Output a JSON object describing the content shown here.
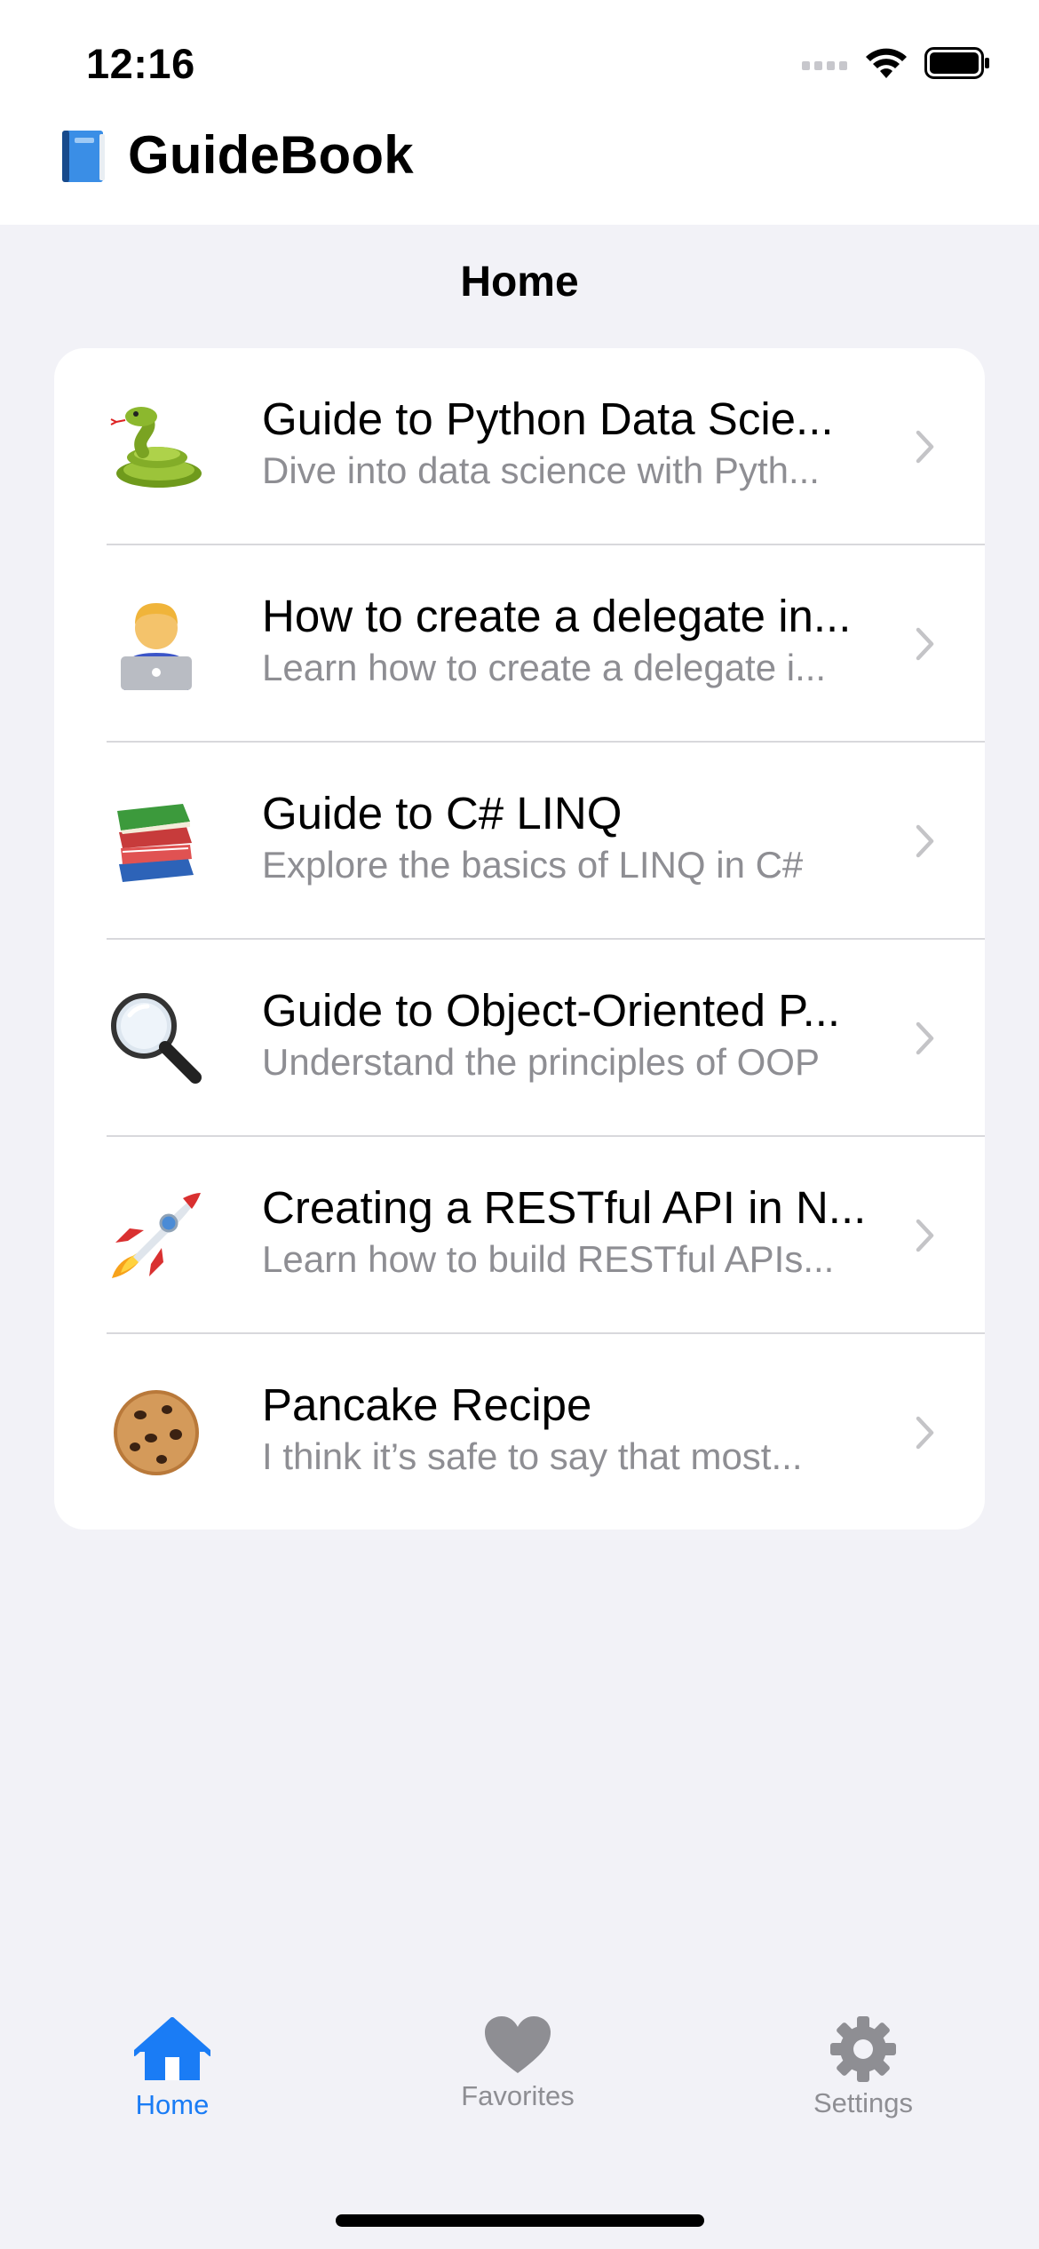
{
  "status_bar": {
    "time": "12:16"
  },
  "header": {
    "app_icon": "blue-book-icon",
    "app_name": "GuideBook"
  },
  "page": {
    "title": "Home"
  },
  "guides": [
    {
      "icon": "snake-emoji",
      "title": "Guide to Python Data Scie...",
      "subtitle": "Dive into data science with Pyth..."
    },
    {
      "icon": "technologist-emoji",
      "title": "How to create a delegate in...",
      "subtitle": "Learn how to create a delegate i..."
    },
    {
      "icon": "books-emoji",
      "title": "Guide to C# LINQ",
      "subtitle": "Explore the basics of LINQ in C#"
    },
    {
      "icon": "magnifying-glass-emoji",
      "title": "Guide to Object-Oriented P...",
      "subtitle": "Understand the principles of OOP"
    },
    {
      "icon": "rocket-emoji",
      "title": "Creating a RESTful API in N...",
      "subtitle": "Learn how to build RESTful APIs..."
    },
    {
      "icon": "cookie-emoji",
      "title": "Pancake Recipe",
      "subtitle": "I think it’s safe to say that most..."
    }
  ],
  "tabs": [
    {
      "label": "Home",
      "icon": "house-icon",
      "active": true
    },
    {
      "label": "Favorites",
      "icon": "heart-icon",
      "active": false
    },
    {
      "label": "Settings",
      "icon": "gear-icon",
      "active": false
    }
  ],
  "colors": {
    "accent": "#1a7cf5",
    "inactive": "#8e8e93",
    "background": "#f2f2f7",
    "card": "#ffffff"
  }
}
